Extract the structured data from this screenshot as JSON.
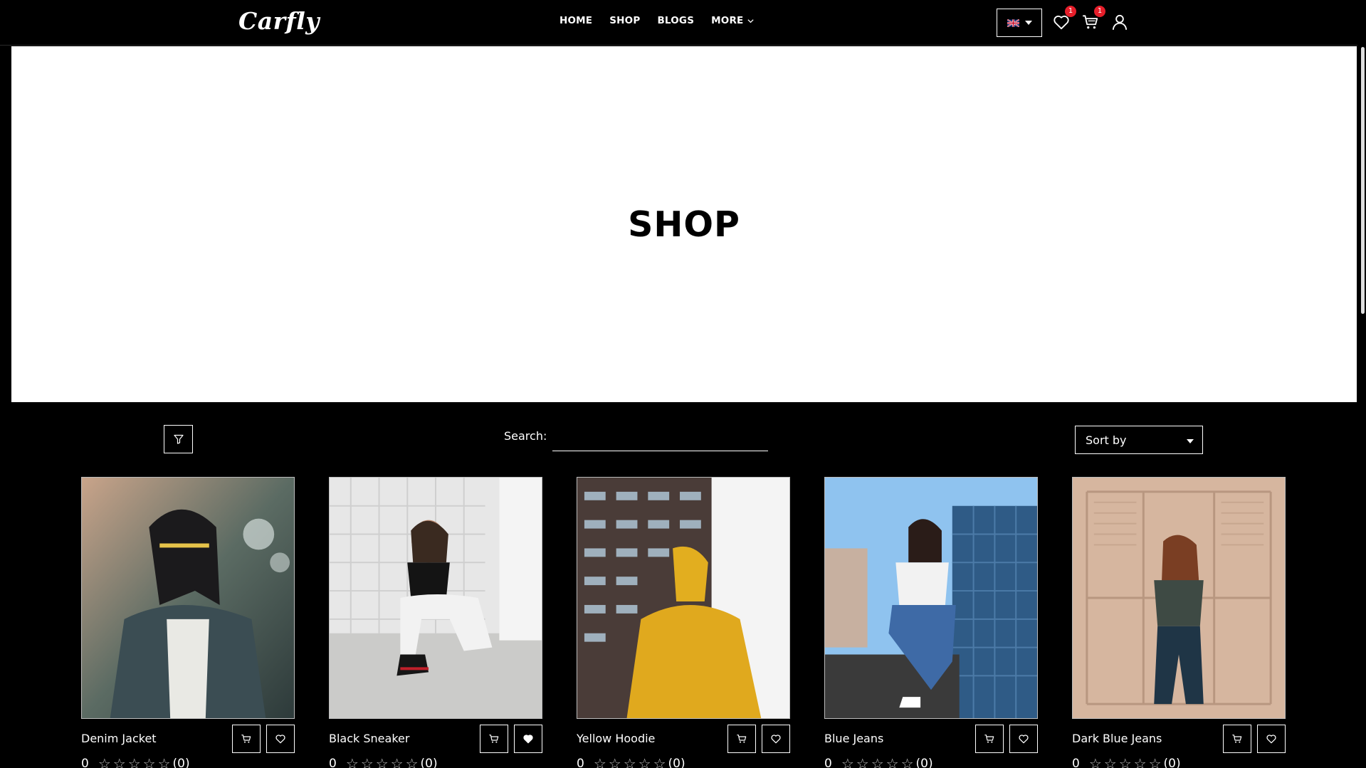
{
  "header": {
    "logo": "Carfly",
    "nav": [
      {
        "label": "HOME"
      },
      {
        "label": "SHOP"
      },
      {
        "label": "BLOGS"
      },
      {
        "label": "MORE"
      }
    ],
    "wishlist_count": "1",
    "cart_count": "1"
  },
  "hero": {
    "title": "SHOP"
  },
  "toolbar": {
    "search_label": "Search:",
    "search_value": "",
    "sort_label": "Sort by"
  },
  "products": [
    {
      "name": "Denim Jacket",
      "rating": "0",
      "reviews": "(0)",
      "wishlisted": false
    },
    {
      "name": "Black Sneaker",
      "rating": "0",
      "reviews": "(0)",
      "wishlisted": true
    },
    {
      "name": "Yellow Hoodie",
      "rating": "0",
      "reviews": "(0)",
      "wishlisted": false
    },
    {
      "name": "Blue Jeans",
      "rating": "0",
      "reviews": "(0)",
      "wishlisted": false
    },
    {
      "name": "Dark Blue Jeans",
      "rating": "0",
      "reviews": "(0)",
      "wishlisted": false
    }
  ],
  "icons": {
    "filter": "filter-icon",
    "cart": "cart-icon",
    "wishlist": "heart-icon",
    "user": "user-icon"
  },
  "colors": {
    "badge": "#e61e2a",
    "background": "#000000",
    "hero": "#ffffff"
  }
}
